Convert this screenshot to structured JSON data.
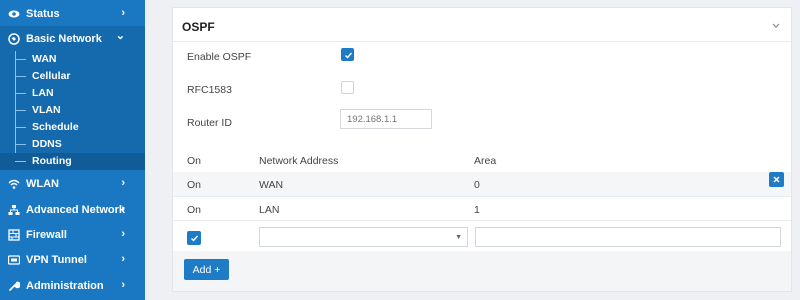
{
  "sidebar": {
    "items": [
      {
        "label": "Status",
        "icon": "eye-icon",
        "chevron": "›"
      },
      {
        "label": "Basic Network",
        "icon": "globe-icon",
        "chevron": "⌄"
      },
      {
        "label": "WLAN",
        "icon": "wifi-icon",
        "chevron": "›"
      },
      {
        "label": "Advanced Network",
        "icon": "network-icon",
        "chevron": "›"
      },
      {
        "label": "Firewall",
        "icon": "firewall-icon",
        "chevron": "›"
      },
      {
        "label": "VPN Tunnel",
        "icon": "vpn-icon",
        "chevron": "›"
      },
      {
        "label": "Administration",
        "icon": "wrench-icon",
        "chevron": "›"
      }
    ],
    "sub_items": [
      "WAN",
      "Cellular",
      "LAN",
      "VLAN",
      "Schedule",
      "DDNS",
      "Routing"
    ],
    "active_sub_item": "Routing"
  },
  "ospf": {
    "title": "OSPF",
    "enable_label": "Enable OSPF",
    "enable_checked": true,
    "rfc_label": "RFC1583",
    "rfc_checked": false,
    "router_id_label": "Router ID",
    "router_id_placeholder": "192.168.1.1",
    "table": {
      "headers": [
        "On",
        "Network Address",
        "Area"
      ],
      "rows": [
        {
          "on": "On",
          "network": "WAN",
          "area": "0"
        },
        {
          "on": "On",
          "network": "LAN",
          "area": "1"
        }
      ]
    },
    "new_row_checked": true,
    "add_label": "Add +"
  },
  "colors": {
    "sidebar_bg": "#1a78c2",
    "accent": "#1e7bc6",
    "page_bg": "#eef0f3"
  }
}
